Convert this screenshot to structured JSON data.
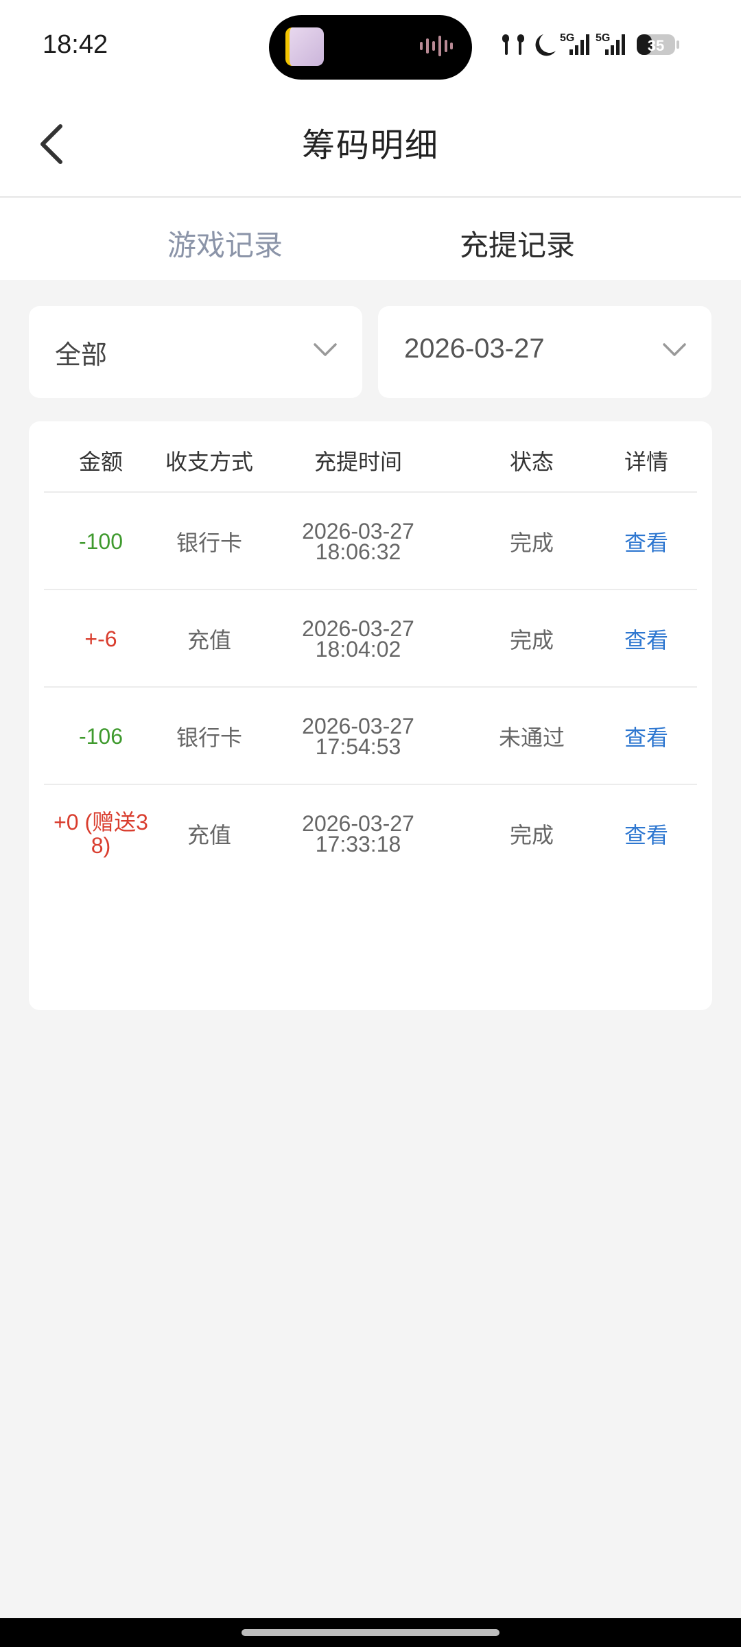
{
  "status_bar": {
    "time": "18:42",
    "network_1": "5G",
    "network_2": "5G",
    "battery": "35",
    "icons": [
      "earbuds-icon",
      "moon-icon",
      "signal-icon",
      "battery-icon"
    ]
  },
  "header": {
    "title": "筹码明细",
    "back_icon": "chevron-left-icon"
  },
  "tabs": [
    {
      "label": "游戏记录",
      "active": false
    },
    {
      "label": "充提记录",
      "active": true
    }
  ],
  "filters": {
    "type": "全部",
    "date": "2026-03-27",
    "chevron_icon": "chevron-down-icon"
  },
  "table": {
    "headers": {
      "amount": "金额",
      "method": "收支方式",
      "time": "充提时间",
      "status": "状态",
      "detail": "详情"
    },
    "rows": [
      {
        "amount": "-100",
        "amount_sign": "neg",
        "method": "银行卡",
        "date": "2026-03-27",
        "time": "18:06:32",
        "status": "完成",
        "detail": "查看"
      },
      {
        "amount": "+-6",
        "amount_sign": "pos",
        "method": "充值",
        "date": "2026-03-27",
        "time": "18:04:02",
        "status": "完成",
        "detail": "查看"
      },
      {
        "amount": "-106",
        "amount_sign": "neg",
        "method": "银行卡",
        "date": "2026-03-27",
        "time": "17:54:53",
        "status": "未通过",
        "detail": "查看"
      },
      {
        "amount": "+0 (赠送38)",
        "amount_sign": "pos",
        "method": "充值",
        "date": "2026-03-27",
        "time": "17:33:18",
        "status": "完成",
        "detail": "查看"
      }
    ]
  },
  "colors": {
    "negative": "#3f9a2e",
    "positive": "#d93d2e",
    "link": "#2e77d0",
    "tab_inactive": "#8b94a8"
  }
}
